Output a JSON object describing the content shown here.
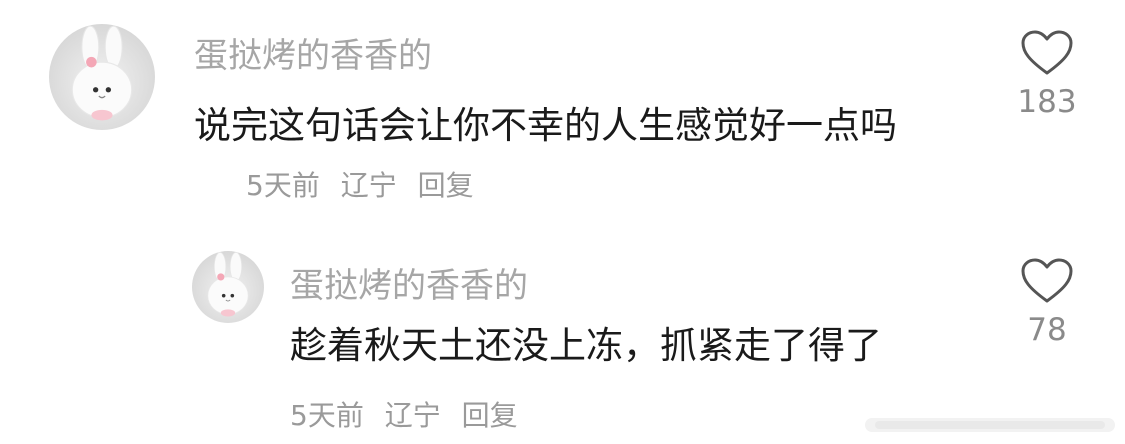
{
  "comments": [
    {
      "username": "蛋挞烤的香香的",
      "text": "说完这句话会让你不幸的人生感觉好一点吗",
      "time": "5天前",
      "location": "辽宁",
      "reply_label": "回复",
      "likes": "183",
      "avatar_icon": "bunny-avatar"
    },
    {
      "username": "蛋挞烤的香香的",
      "text": "趁着秋天土还没上冻，抓紧走了得了",
      "time": "5天前",
      "location": "辽宁",
      "reply_label": "回复",
      "likes": "78",
      "avatar_icon": "bunny-avatar"
    }
  ],
  "icons": {
    "like": "heart-outline-icon"
  },
  "colors": {
    "username": "#a6a6a6",
    "meta": "#9a9a9a",
    "text": "#1a1a1a"
  }
}
